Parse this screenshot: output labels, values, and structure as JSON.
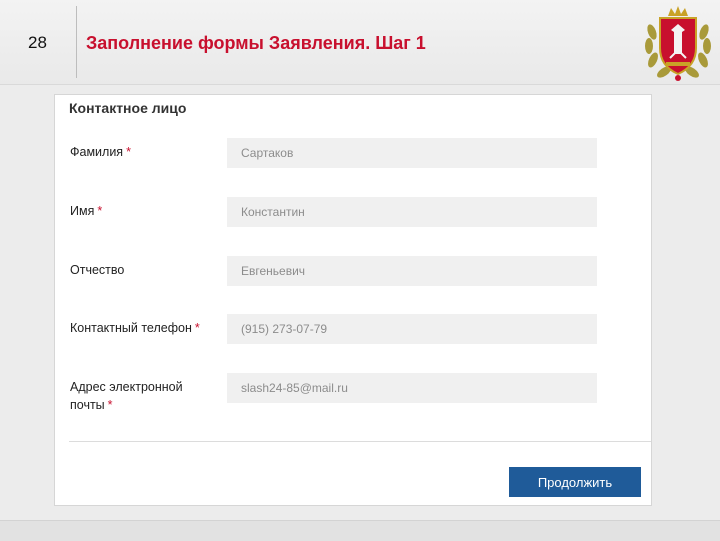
{
  "slide": {
    "number": "28",
    "title": "Заполнение формы Заявления. Шаг 1",
    "emblem_icon": "coat-of-arms-icon"
  },
  "form": {
    "section_title": "Контактное лицо",
    "required_mark": "*",
    "fields": [
      {
        "label": "Фамилия",
        "required": true,
        "value": "Сартаков"
      },
      {
        "label": "Имя",
        "required": true,
        "value": "Константин"
      },
      {
        "label": "Отчество",
        "required": false,
        "value": "Евгеньевич"
      },
      {
        "label": "Контактный телефон",
        "required": true,
        "value": "(915) 273-07-79"
      },
      {
        "label": "Адрес электронной почты",
        "required": true,
        "value": "slash24-85@mail.ru"
      }
    ],
    "continue_label": "Продолжить"
  },
  "colors": {
    "accent_red": "#c8102e",
    "button_blue": "#1f5b99",
    "input_bg": "#f0f0f0"
  }
}
